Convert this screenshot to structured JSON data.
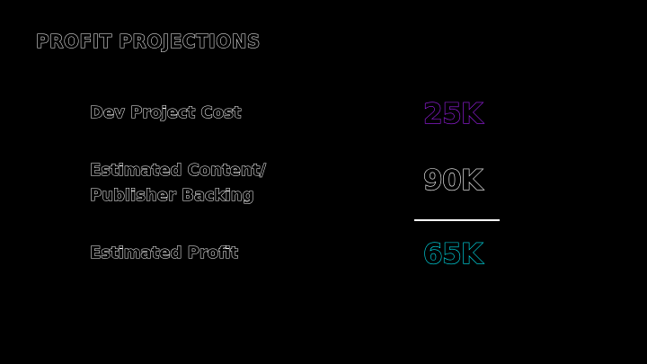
{
  "title": "PROFIT PROJECTIONS",
  "rows": [
    {
      "label": "Dev Project Cost",
      "value": "25K",
      "color": "#a020f0"
    },
    {
      "label_line1": "Estimated Content/",
      "label_line2": "Publisher Backing",
      "value": "90K",
      "color": "#ffffff"
    },
    {
      "label": "Estimated Profit",
      "value": "65K",
      "color": "#00e5f0"
    }
  ],
  "colors": {
    "background": "#000000",
    "text_outline": "#ffffff",
    "divider": "#ffffff"
  }
}
